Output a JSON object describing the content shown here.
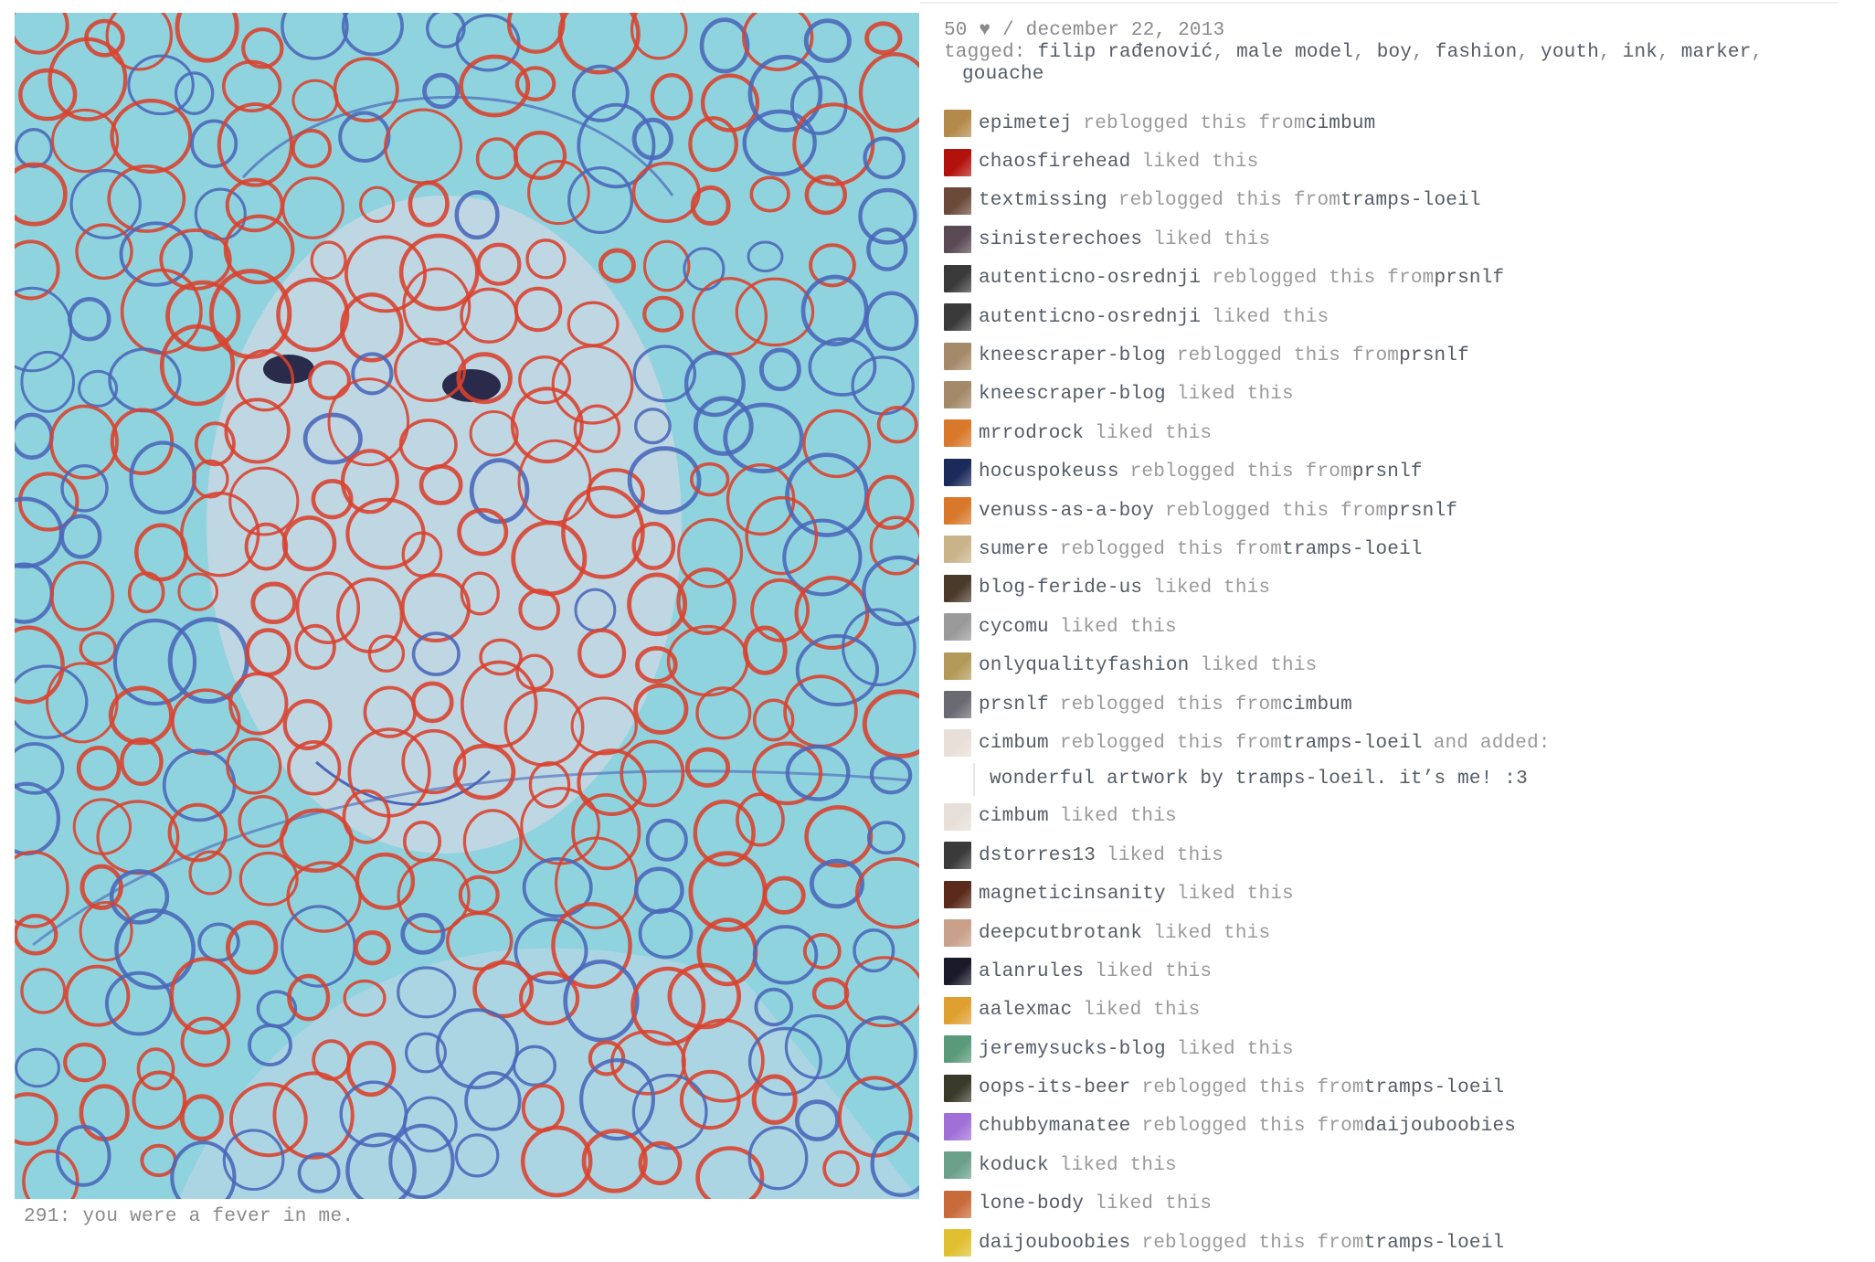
{
  "post": {
    "caption": "291: you were a fever in me.",
    "artwork_alt": "ink and marker portrait of a young man covered by red and blue circles on a turquoise background"
  },
  "meta": {
    "notes_count": "50",
    "heart": "♥",
    "separator": "/",
    "date": "december 22, 2013",
    "tagged_label": "tagged:",
    "tags": [
      "filip rađenović",
      "male model",
      "boy",
      "fashion",
      "youth",
      "ink",
      "marker",
      "gouache"
    ]
  },
  "notes": [
    {
      "user": "epimetej",
      "action": "reblogged this from",
      "source": "cimbum",
      "avatar": "#b38a4a"
    },
    {
      "user": "chaosfirehead",
      "action": "liked this",
      "source": "",
      "avatar": "#b3120c"
    },
    {
      "user": "textmissing",
      "action": "reblogged this from",
      "source": "tramps-loeil",
      "avatar": "#6b4a3a"
    },
    {
      "user": "sinisterechoes",
      "action": "liked this",
      "source": "",
      "avatar": "#5a4a55"
    },
    {
      "user": "autenticno-osrednji",
      "action": "reblogged this from",
      "source": "prsnlf",
      "avatar": "#3a3a3a"
    },
    {
      "user": "autenticno-osrednji",
      "action": "liked this",
      "source": "",
      "avatar": "#3a3a3a"
    },
    {
      "user": "kneescraper-blog",
      "action": "reblogged this from",
      "source": "prsnlf",
      "avatar": "#a58a6a"
    },
    {
      "user": "kneescraper-blog",
      "action": "liked this",
      "source": "",
      "avatar": "#a58a6a"
    },
    {
      "user": "mrrodrock",
      "action": "liked this",
      "source": "",
      "avatar": "#d9782a"
    },
    {
      "user": "hocuspokeuss",
      "action": "reblogged this from",
      "source": "prsnlf",
      "avatar": "#1a2a5a"
    },
    {
      "user": "venuss-as-a-boy",
      "action": "reblogged this from",
      "source": "prsnlf",
      "avatar": "#d9782a"
    },
    {
      "user": "sumere",
      "action": "reblogged this from",
      "source": "tramps-loeil",
      "avatar": "#c9b48a"
    },
    {
      "user": "blog-feride-us",
      "action": "liked this",
      "source": "",
      "avatar": "#4a3a2a"
    },
    {
      "user": "cycomu",
      "action": "liked this",
      "source": "",
      "avatar": "#9a9a9a"
    },
    {
      "user": "onlyqualityfashion",
      "action": "liked this",
      "source": "",
      "avatar": "#b39a5a"
    },
    {
      "user": "prsnlf",
      "action": "reblogged this from",
      "source": "cimbum",
      "avatar": "#6a6a72"
    },
    {
      "user": "cimbum",
      "action": "reblogged this from",
      "source": "tramps-loeil",
      "suffix": "and added:",
      "avatar": "#e8e0d8"
    },
    {
      "quote": "wonderful artwork by tramps-loeil. it’s me! :3"
    },
    {
      "user": "cimbum",
      "action": "liked this",
      "source": "",
      "avatar": "#e8e0d8"
    },
    {
      "user": "dstorres13",
      "action": "liked this",
      "source": "",
      "avatar": "#3a3a3a"
    },
    {
      "user": "magneticinsanity",
      "action": "liked this",
      "source": "",
      "avatar": "#5a2a1a"
    },
    {
      "user": "deepcutbrotank",
      "action": "liked this",
      "source": "",
      "avatar": "#c9a08a"
    },
    {
      "user": "alanrules",
      "action": "liked this",
      "source": "",
      "avatar": "#1a1a2a"
    },
    {
      "user": "aalexmac",
      "action": "liked this",
      "source": "",
      "avatar": "#e0a030"
    },
    {
      "user": "jeremysucks-blog",
      "action": "liked this",
      "source": "",
      "avatar": "#5a9a7a"
    },
    {
      "user": "oops-its-beer",
      "action": "reblogged this from",
      "source": "tramps-loeil",
      "avatar": "#3a3a2a"
    },
    {
      "user": "chubbymanatee",
      "action": "reblogged this from",
      "source": "daijouboobies",
      "avatar": "#a070d8"
    },
    {
      "user": "koduck",
      "action": "liked this",
      "source": "",
      "avatar": "#6aa08a"
    },
    {
      "user": "lone-body",
      "action": "liked this",
      "source": "",
      "avatar": "#c96a3a"
    },
    {
      "user": "daijouboobies",
      "action": "reblogged this from",
      "source": "tramps-loeil",
      "avatar": "#e0c030"
    }
  ],
  "colors": {
    "artwork_bg": "#8fd3df",
    "circle_red": "#d9412c",
    "circle_blue": "#4a66b8",
    "link": "#555c66",
    "muted": "#9a9a9a"
  }
}
